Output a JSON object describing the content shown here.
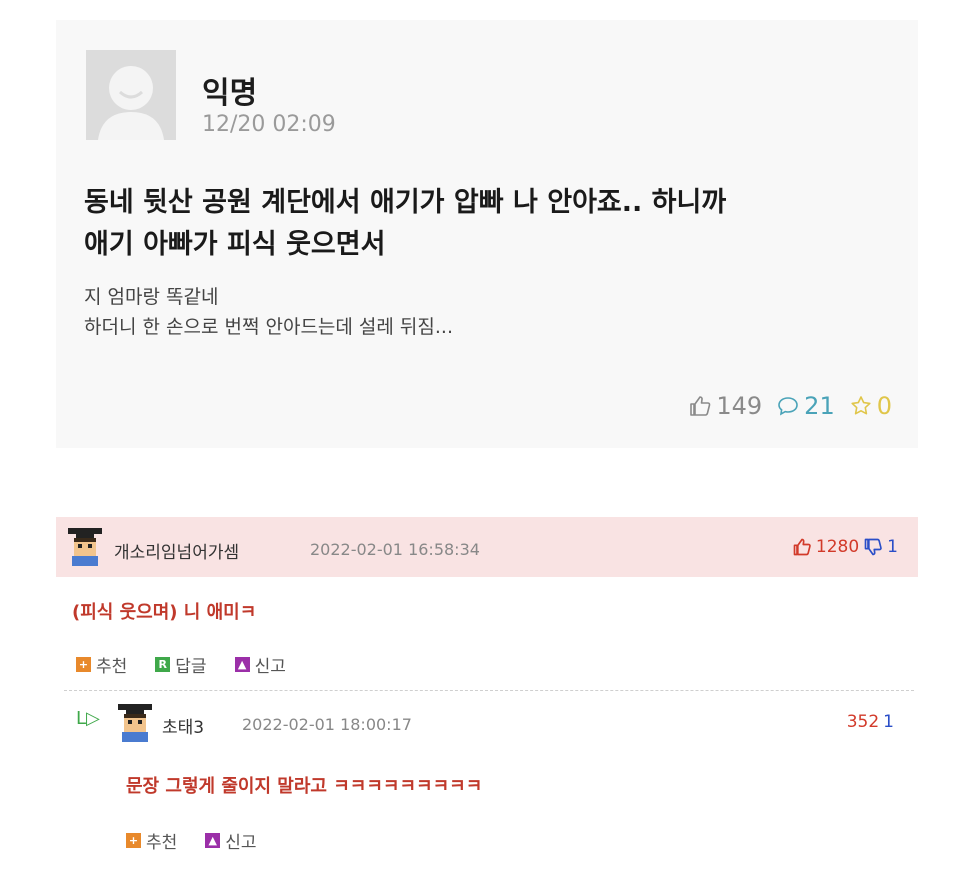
{
  "post": {
    "author": "익명",
    "date": "12/20 02:09",
    "title_line1": "동네 뒷산 공원 계단에서 애기가 압빠 나 안아죠.. 하니까",
    "title_line2": "애기 아빠가 피식 웃으면서",
    "body_line1": "지 엄마랑 똑같네",
    "body_line2": "하더니 한 손으로 번쩍 안아드는데 설레 뒤짐...",
    "likes": "149",
    "comments": "21",
    "scraps": "0"
  },
  "comment": {
    "name": "개소리임넘어가셈",
    "date": "2022-02-01 16:58:34",
    "up": "1280",
    "down": "1",
    "text": "(피식 웃으며) 니 애미ㅋ",
    "actions": {
      "recommend": "추천",
      "reply": "답글",
      "report": "신고",
      "reply_icon": "R"
    }
  },
  "reply": {
    "arrow": "L▷",
    "name": "초태3",
    "date": "2022-02-01 18:00:17",
    "up": "352",
    "down": "1",
    "text": "문장 그렇게 줄이지 말라고 ㅋㅋㅋㅋㅋㅋㅋㅋㅋ",
    "actions": {
      "recommend": "추천",
      "report": "신고"
    }
  },
  "colors": {
    "comment_highlight": "#f9e3e3",
    "comment_text": "#c0392b",
    "upvote": "#d23a2a",
    "downvote": "#2a4ec8"
  }
}
